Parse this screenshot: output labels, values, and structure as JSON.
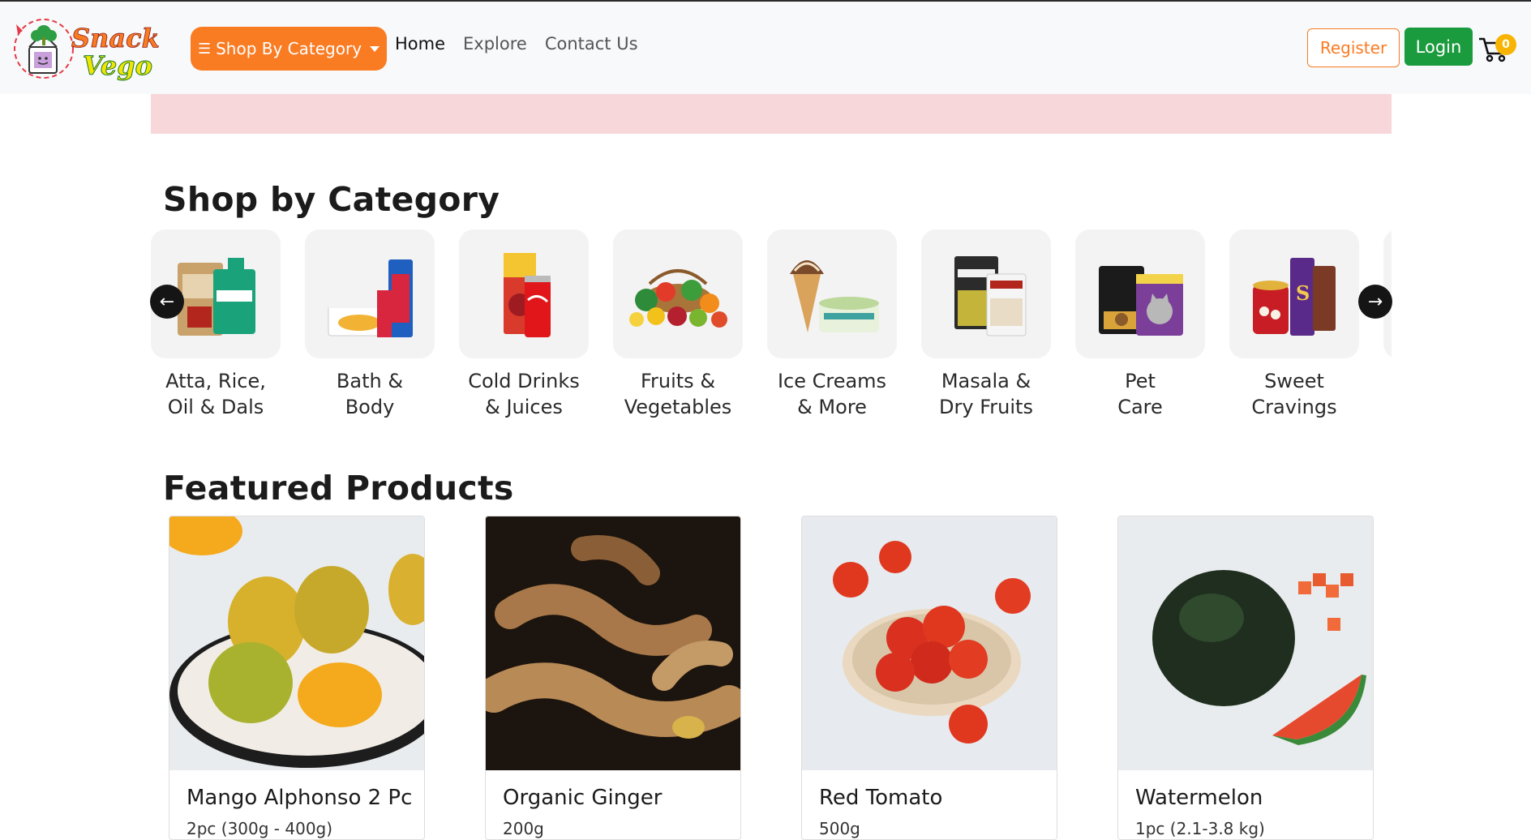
{
  "brand": {
    "name_line1": "Snack",
    "name_line2": "Vego"
  },
  "header": {
    "category_button": "Shop By Category",
    "nav": [
      "Home",
      "Explore",
      "Contact Us"
    ],
    "register": "Register",
    "login": "Login",
    "cart_count": "0"
  },
  "categories_section": {
    "title": "Shop by Category",
    "items": [
      {
        "line1": "Atta, Rice,",
        "line2": "Oil & Dals",
        "icon": "grocery-bags-icon"
      },
      {
        "line1": "Bath &",
        "line2": "Body",
        "icon": "toiletries-icon"
      },
      {
        "line1": "Cold Drinks",
        "line2": "& Juices",
        "icon": "drinks-icon"
      },
      {
        "line1": "Fruits &",
        "line2": "Vegetables",
        "icon": "produce-basket-icon"
      },
      {
        "line1": "Ice Creams",
        "line2": "& More",
        "icon": "ice-cream-icon"
      },
      {
        "line1": "Masala &",
        "line2": "Dry Fruits",
        "icon": "spice-packs-icon"
      },
      {
        "line1": "Pet",
        "line2": "Care",
        "icon": "pet-food-icon"
      },
      {
        "line1": "Sweet",
        "line2": "Cravings",
        "icon": "sweets-icon"
      }
    ]
  },
  "featured_section": {
    "title": "Featured Products",
    "products": [
      {
        "name": "Mango Alphonso 2 Pc",
        "qty": "2pc (300g - 400g)"
      },
      {
        "name": "Organic Ginger",
        "qty": "200g"
      },
      {
        "name": "Red Tomato",
        "qty": "500g"
      },
      {
        "name": "Watermelon",
        "qty": "1pc (2.1-3.8 kg)"
      }
    ]
  },
  "colors": {
    "accent_orange": "#f97b22",
    "login_green": "#1a9b3e",
    "banner_pink": "#f8d7da",
    "badge_yellow": "#f8b400"
  }
}
